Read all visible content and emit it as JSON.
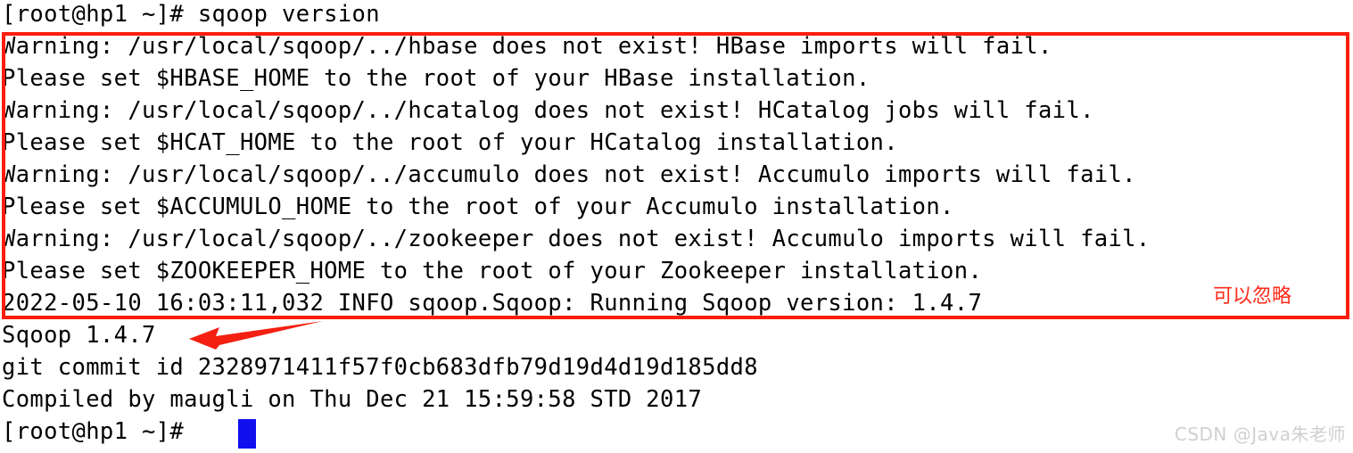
{
  "terminal": {
    "lines": [
      "[root@hp1 ~]# sqoop version",
      "Warning: /usr/local/sqoop/../hbase does not exist! HBase imports will fail.",
      "Please set $HBASE_HOME to the root of your HBase installation.",
      "Warning: /usr/local/sqoop/../hcatalog does not exist! HCatalog jobs will fail.",
      "Please set $HCAT_HOME to the root of your HCatalog installation.",
      "Warning: /usr/local/sqoop/../accumulo does not exist! Accumulo imports will fail.",
      "Please set $ACCUMULO_HOME to the root of your Accumulo installation.",
      "Warning: /usr/local/sqoop/../zookeeper does not exist! Accumulo imports will fail.",
      "Please set $ZOOKEEPER_HOME to the root of your Zookeeper installation.",
      "2022-05-10 16:03:11,032 INFO sqoop.Sqoop: Running Sqoop version: 1.4.7",
      "Sqoop 1.4.7",
      "git commit id 2328971411f57f0cb683dfb79d19d4d19d185dd8",
      "Compiled by maugli on Thu Dec 21 15:59:58 STD 2017",
      "[root@hp1 ~]# "
    ],
    "prompt": "[root@hp1 ~]#",
    "command": "sqoop version",
    "cursor_visible": true,
    "cursor_color": "#1010ee",
    "text_color": "#000000",
    "background_color": "#ffffff"
  },
  "annotations": {
    "highlight_box": {
      "color": "#fa1e0e",
      "covers_lines": "Warning/Please warning block through the INFO Running Sqoop version line"
    },
    "note_text": "可以忽略",
    "note_color": "#ff2a1a",
    "arrow": {
      "color": "#f42012",
      "direction": "left",
      "points_to": "Sqoop 1.4.7"
    }
  },
  "watermark": {
    "text": "CSDN @Java朱老师",
    "color": "#d0d0d0"
  }
}
